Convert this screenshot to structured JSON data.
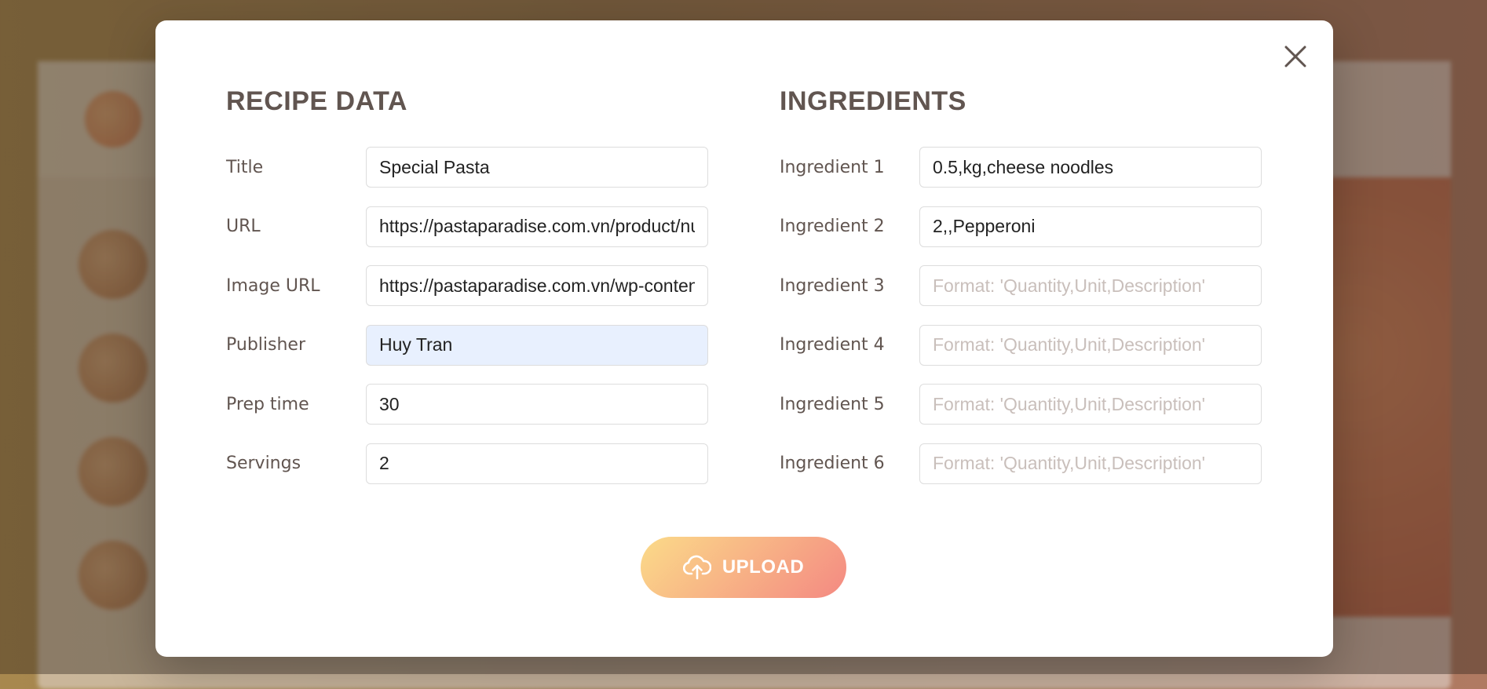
{
  "recipe_section": {
    "heading": "RECIPE DATA",
    "fields": [
      {
        "label": "Title",
        "value": "Special Pasta",
        "placeholder": ""
      },
      {
        "label": "URL",
        "value": "https://pastaparadise.com.vn/product/nui",
        "placeholder": ""
      },
      {
        "label": "Image URL",
        "value": "https://pastaparadise.com.vn/wp-content",
        "placeholder": ""
      },
      {
        "label": "Publisher",
        "value": "Huy Tran",
        "placeholder": ""
      },
      {
        "label": "Prep time",
        "value": "30",
        "placeholder": ""
      },
      {
        "label": "Servings",
        "value": "2",
        "placeholder": ""
      }
    ]
  },
  "ingredients_section": {
    "heading": "INGREDIENTS",
    "fields": [
      {
        "label": "Ingredient 1",
        "value": "0.5,kg,cheese noodles",
        "placeholder": "Format: 'Quantity,Unit,Description'"
      },
      {
        "label": "Ingredient 2",
        "value": "2,,Pepperoni",
        "placeholder": "Format: 'Quantity,Unit,Description'"
      },
      {
        "label": "Ingredient 3",
        "value": "",
        "placeholder": "Format: 'Quantity,Unit,Description'"
      },
      {
        "label": "Ingredient 4",
        "value": "",
        "placeholder": "Format: 'Quantity,Unit,Description'"
      },
      {
        "label": "Ingredient 5",
        "value": "",
        "placeholder": "Format: 'Quantity,Unit,Description'"
      },
      {
        "label": "Ingredient 6",
        "value": "",
        "placeholder": "Format: 'Quantity,Unit,Description'"
      }
    ]
  },
  "upload_button": {
    "label": "UPLOAD",
    "icon": "cloud-upload-icon"
  },
  "close_button": {
    "icon": "close-icon"
  },
  "colors": {
    "heading": "#615550",
    "upload_gradient_start": "#fbdb89",
    "upload_gradient_end": "#f48982",
    "autofill_background": "#e8f0fe"
  }
}
